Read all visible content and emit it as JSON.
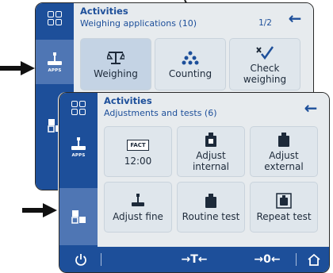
{
  "screen1": {
    "title": "Activities",
    "subtitle": "Weighing applications (10)",
    "page": "1/2",
    "sidebar": {
      "apps_label": "APPS"
    },
    "tiles": [
      {
        "label": "Weighing",
        "icon": "balance-scale-icon"
      },
      {
        "label": "Counting",
        "icon": "dots-counting-icon"
      },
      {
        "label": "Check weighing",
        "icon": "check-weighing-icon"
      }
    ]
  },
  "screen2": {
    "title": "Activities",
    "subtitle": "Adjustments and tests (6)",
    "sidebar": {
      "apps_label": "APPS"
    },
    "tiles": [
      {
        "label": "12:00",
        "badge": "FACT",
        "icon": "fact-clock-icon"
      },
      {
        "label": "Adjust internal",
        "icon": "weight-icon"
      },
      {
        "label": "Adjust external",
        "icon": "external-weight-icon"
      },
      {
        "label": "Adjust fine",
        "icon": "fine-adjust-icon"
      },
      {
        "label": "Routine test",
        "icon": "routine-test-icon"
      },
      {
        "label": "Repeat test",
        "icon": "repeat-test-icon"
      }
    ],
    "footer": {
      "tare": "→T←",
      "zero": "→0←"
    }
  },
  "colors": {
    "primary": "#1d4f9a",
    "active": "#4f76b4",
    "tile": "#dfe6ec",
    "background": "#e7ebee"
  }
}
